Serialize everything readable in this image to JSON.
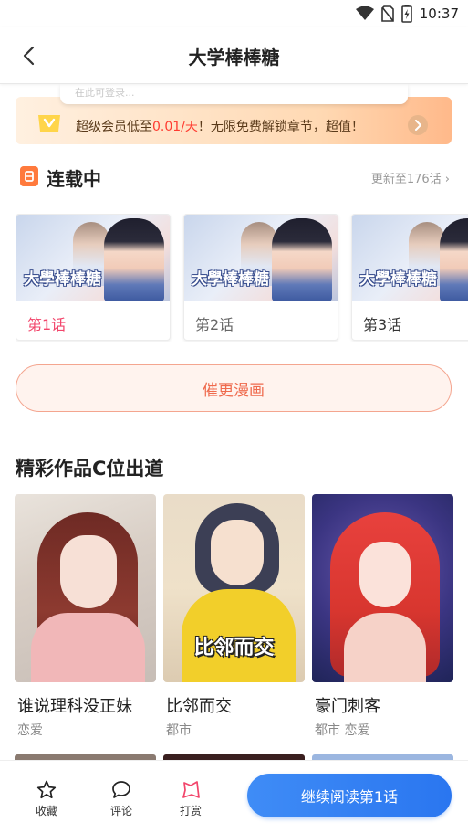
{
  "status_bar": {
    "time": "10:37",
    "icons": [
      "wifi-icon",
      "no-sim-icon",
      "battery-charging-icon"
    ]
  },
  "header": {
    "title": "大学棒棒糖",
    "back_icon": "chevron-left-icon"
  },
  "peek_text": "在此可登录...",
  "vip_banner": {
    "prefix": "超级会员低至",
    "price": "0.01/天",
    "suffix": "！无限免费解锁章节，超值！",
    "badge_icon": "vip-badge-icon",
    "arrow_icon": "chevron-right-icon"
  },
  "serial_section": {
    "title": "连载中",
    "update_text": "更新至176话",
    "update_icon": "chevron-right-small-icon",
    "episodes": [
      {
        "label": "第1话",
        "cover_text": "大學棒棒糖",
        "state": "active"
      },
      {
        "label": "第2话",
        "cover_text": "大學棒棒糖",
        "state": "normal"
      },
      {
        "label": "第3话",
        "cover_text": "大學棒棒糖",
        "state": "dark"
      }
    ]
  },
  "urge_button": {
    "label": "催更漫画"
  },
  "recommend_section": {
    "title": "精彩作品C位出道",
    "works": [
      {
        "name": "谁说理科没正妹",
        "tags": "恋爱",
        "cover_text": ""
      },
      {
        "name": "比邻而交",
        "tags": "都市",
        "cover_text": "比邻而交"
      },
      {
        "name": "豪门刺客",
        "tags": "都市 恋爱",
        "cover_text": ""
      }
    ]
  },
  "bottom_bar": {
    "tabs": [
      {
        "label": "收藏",
        "icon": "star-icon"
      },
      {
        "label": "评论",
        "icon": "comment-bubble-icon"
      },
      {
        "label": "打赏",
        "icon": "reward-icon"
      }
    ],
    "read_button": "继续阅读第1话"
  },
  "colors": {
    "accent_pink": "#f2456b",
    "urge_orange": "#ef6a4d",
    "primary_blue": "#2a76f0",
    "vip_price_red": "#ff3b30"
  }
}
